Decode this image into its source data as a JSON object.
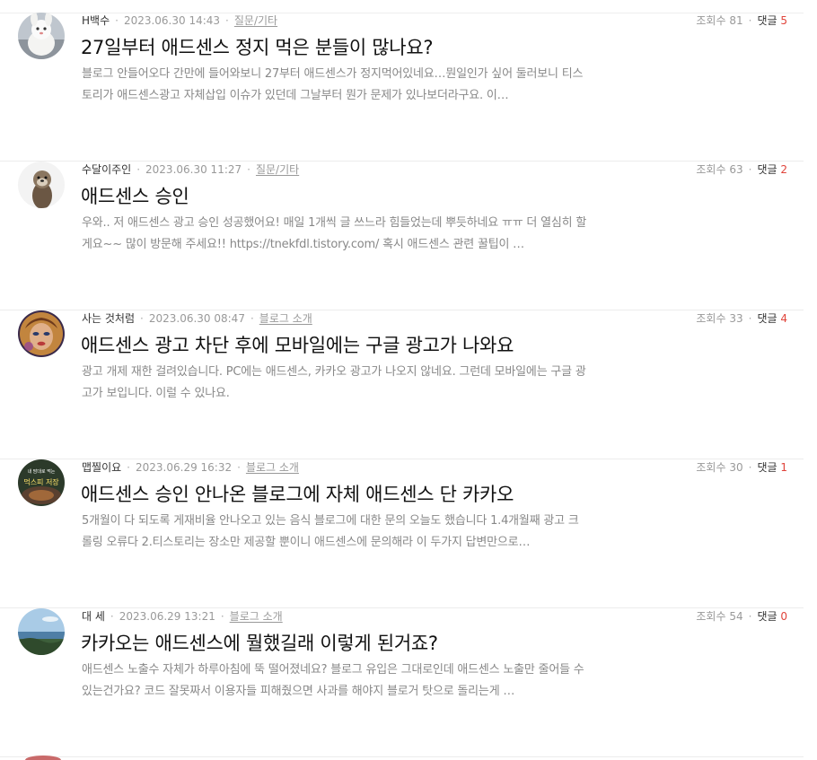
{
  "posts": [
    {
      "author": "H백수",
      "date": "2023.06.30 14:43",
      "category": "질문/기타",
      "views_label": "조회수 81",
      "comments_label": "댓글",
      "comments_count": "5",
      "title": "27일부터 애드센스 정지 먹은 분들이 많나요?",
      "excerpt": "블로그 안들어오다 간만에 들어와보니 27부터 애드센스가 정지먹어있네요…뭔일인가 싶어 둘러보니 티스토리가 애드센스광고 자체삽입 이슈가 있던데 그날부터 뭔가 문제가 있나보더라구요. 이…",
      "avatar_icon": "white-plush-toy-avatar"
    },
    {
      "author": "수달이주인",
      "date": "2023.06.30 11:27",
      "category": "질문/기타",
      "views_label": "조회수 63",
      "comments_label": "댓글",
      "comments_count": "2",
      "title": "애드센스 승인",
      "excerpt": "우와.. 저 애드센스 광고 승인 성공했어요! 매일 1개씩 글 쓰느라 힘들었는데 뿌듯하네요 ㅠㅠ 더 열심히 할게요~~ 많이 방문해 주세요!! https://tnekfdl.tistory.com/ 혹시 애드센스 관련 꿀팁이 …",
      "avatar_icon": "otter-avatar"
    },
    {
      "author": "사는 것처럼",
      "date": "2023.06.30 08:47",
      "category": "블로그 소개",
      "views_label": "조회수 33",
      "comments_label": "댓글",
      "comments_count": "4",
      "title": "애드센스 광고 차단 후에 모바일에는 구글 광고가 나와요",
      "excerpt": "광고 개제 재한 걸려있습니다. PC에는 애드센스, 카카오 광고가 나오지 않네요. 그런데 모바일에는 구글 광고가 보입니다. 이럴 수 있나요.",
      "avatar_icon": "portrait-avatar"
    },
    {
      "author": "맵찔이요",
      "date": "2023.06.29 16:32",
      "category": "블로그 소개",
      "views_label": "조회수 30",
      "comments_label": "댓글",
      "comments_count": "1",
      "title": "애드센스 승인 안나온 블로그에 자체 애드센스 단 카카오",
      "excerpt": "5개월이 다 되도록 게재비율 안나오고 있는 음식 블로그에 대한 문의 오늘도 했습니다 1.4개월째 광고 크롤링 오류다 2.티스토리는 장소만 제공할 뿐이니 애드센스에 문의해라 이 두가지 답변만으로…",
      "avatar_icon": "food-photo-avatar",
      "avatar_text_top": "내 맘대로 먹는",
      "avatar_text_main": "먹스피 저장"
    },
    {
      "author": "대 세",
      "date": "2023.06.29 13:21",
      "category": "블로그 소개",
      "views_label": "조회수 54",
      "comments_label": "댓글",
      "comments_count": "0",
      "title": "카카오는 애드센스에 뭘했길래 이렇게 된거죠?",
      "excerpt": "애드센스 노출수 자체가 하루아침에 뚝 떨어졌네요? 블로그 유입은 그대로인데 애드센스 노출만 줄어들 수 있는건가요? 코드 잘못짜서 이용자들 피해줬으면 사과를 해야지 블로거 탓으로 돌리는게 …",
      "avatar_icon": "seaside-landscape-avatar"
    }
  ],
  "colors": {
    "comment_count": "#e0433a",
    "meta_text": "#999999",
    "title_text": "#111111",
    "excerpt_text": "#888888"
  }
}
